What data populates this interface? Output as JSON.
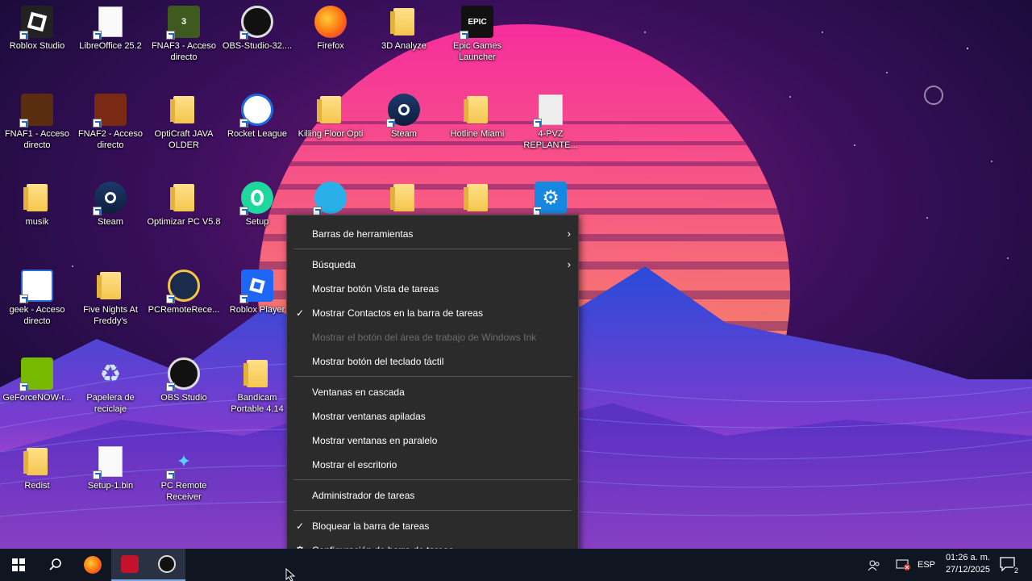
{
  "desktop": {
    "icons": [
      {
        "label": "Roblox Studio",
        "glyph": "roblox-studio-icon"
      },
      {
        "label": "LibreOffice 25.2",
        "glyph": "libreoffice-icon"
      },
      {
        "label": "FNAF3 - Acceso directo",
        "glyph": "fnaf3-icon"
      },
      {
        "label": "OBS-Studio-32....",
        "glyph": "obs-icon"
      },
      {
        "label": "Firefox",
        "glyph": "firefox-icon"
      },
      {
        "label": "3D Analyze",
        "glyph": "folder-icon"
      },
      {
        "label": "Epic Games Launcher",
        "glyph": "epic-games-icon"
      },
      {
        "label": "FNAF1 - Acceso directo",
        "glyph": "fnaf1-icon"
      },
      {
        "label": "FNAF2 - Acceso directo",
        "glyph": "fnaf2-icon"
      },
      {
        "label": "OptiCraft JAVA OLDER",
        "glyph": "folder-icon"
      },
      {
        "label": "Rocket League",
        "glyph": "rocket-league-icon"
      },
      {
        "label": "Killing Floor Opti",
        "glyph": "folder-icon"
      },
      {
        "label": "Steam",
        "glyph": "steam-icon"
      },
      {
        "label": "Hotline Miami",
        "glyph": "folder-icon"
      },
      {
        "label": "4-PVZ REPLANTE...",
        "glyph": "settings-file-icon"
      },
      {
        "label": "musik",
        "glyph": "folder-icon"
      },
      {
        "label": "Steam",
        "glyph": "steam-icon"
      },
      {
        "label": "Optimizar PC V5.8",
        "glyph": "folder-icon"
      },
      {
        "label": "Setup",
        "glyph": "setup-icon"
      },
      {
        "label": "",
        "glyph": "app-icon"
      },
      {
        "label": "",
        "glyph": "folder-icon"
      },
      {
        "label": "",
        "glyph": "folder-icon"
      },
      {
        "label": "",
        "glyph": "gear-icon"
      },
      {
        "label": "geek - Acceso directo",
        "glyph": "geek-icon"
      },
      {
        "label": "Five Nights At Freddy's",
        "glyph": "folder-icon"
      },
      {
        "label": "PCRemoteRece...",
        "glyph": "pc-remote-icon"
      },
      {
        "label": "Roblox Player",
        "glyph": "roblox-player-icon"
      },
      {
        "label": "GeForceNOW-r...",
        "glyph": "geforce-now-icon"
      },
      {
        "label": "Papelera de reciclaje",
        "glyph": "recycle-bin-icon"
      },
      {
        "label": "OBS Studio",
        "glyph": "obs-icon"
      },
      {
        "label": "Bandicam Portable 4.14",
        "glyph": "folder-icon"
      },
      {
        "label": "Redist",
        "glyph": "folder-icon"
      },
      {
        "label": "Setup-1.bin",
        "glyph": "file-icon"
      },
      {
        "label": "PC Remote Receiver",
        "glyph": "pc-remote-receiver-icon"
      }
    ]
  },
  "context_menu": {
    "items": [
      {
        "label": "Barras de herramientas",
        "submenu": true
      },
      {
        "label": "Búsqueda",
        "submenu": true
      },
      {
        "label": "Mostrar botón Vista de tareas"
      },
      {
        "label": "Mostrar Contactos en la barra de tareas",
        "checked": true
      },
      {
        "label": "Mostrar el botón del área de trabajo de Windows Ink",
        "disabled": true
      },
      {
        "label": "Mostrar botón del teclado táctil"
      },
      {
        "label": "Ventanas en cascada"
      },
      {
        "label": "Mostrar ventanas apiladas"
      },
      {
        "label": "Mostrar ventanas en paralelo"
      },
      {
        "label": "Mostrar el escritorio"
      },
      {
        "label": "Administrador de tareas"
      },
      {
        "label": "Bloquear la barra de tareas",
        "checked": true
      },
      {
        "label": "Configuración de barra de tareas",
        "gear": true
      }
    ],
    "check_glyph": "✓",
    "submenu_glyph": "›",
    "gear_glyph": "⚙"
  },
  "taskbar": {
    "apps": [
      "start-icon",
      "search-icon",
      "firefox-icon",
      "game-icon",
      "obs-icon"
    ],
    "language": "ESP",
    "time": "01:26 a. m.",
    "date": "27/12/2025",
    "notification_count": "2"
  },
  "colors": {
    "menu_bg": "#2b2b2b",
    "taskbar_bg": "#101522",
    "sun_top": "#ff2fa0",
    "sun_bottom": "#ffb347"
  }
}
